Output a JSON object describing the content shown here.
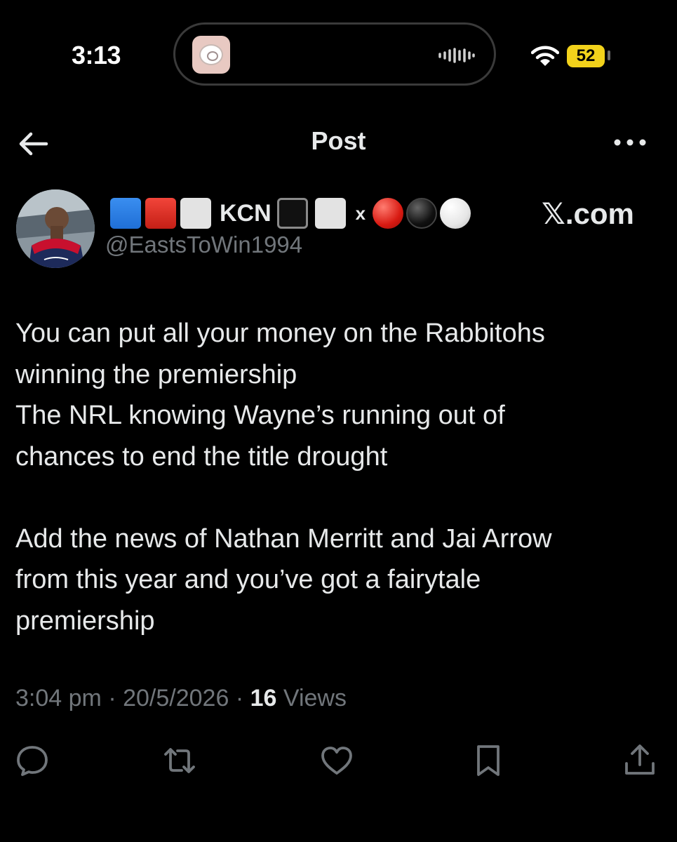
{
  "status_bar": {
    "time": "3:13",
    "battery": "52",
    "icons": [
      "now-playing-art",
      "audio-waveform-icon",
      "wifi-icon",
      "battery-icon"
    ]
  },
  "header": {
    "title": "Post",
    "back_icon": "arrow-left-icon",
    "more_icon": "more-horizontal-icon"
  },
  "author": {
    "name_text": "KCN",
    "separator": "x",
    "handle": "@EastsToWin1994",
    "source": "𝕏.com",
    "emoji_colors": {
      "blue": "#1f6fd6",
      "red": "#d81a12",
      "white": "#e3e3e3",
      "black": "#111111"
    }
  },
  "post": {
    "paragraphs": [
      [
        "You can put all your money on the Rabbitohs",
        "winning the premiership",
        "The NRL knowing Wayne’s running out of",
        "chances to end the title drought"
      ],
      [
        "Add the news of Nathan Merritt and Jai Arrow",
        "from this year and you’ve got a fairytale",
        "premiership"
      ]
    ],
    "time": "3:04 pm",
    "dot": "·",
    "date": "20/5/2026",
    "views_count": "16",
    "views_label": "Views"
  },
  "actions": [
    "reply-icon",
    "repost-icon",
    "like-icon",
    "bookmark-icon",
    "share-icon"
  ],
  "colors": {
    "background": "#000000",
    "text": "#e7e9ea",
    "secondary": "#71767b",
    "battery": "#f2d21b"
  }
}
